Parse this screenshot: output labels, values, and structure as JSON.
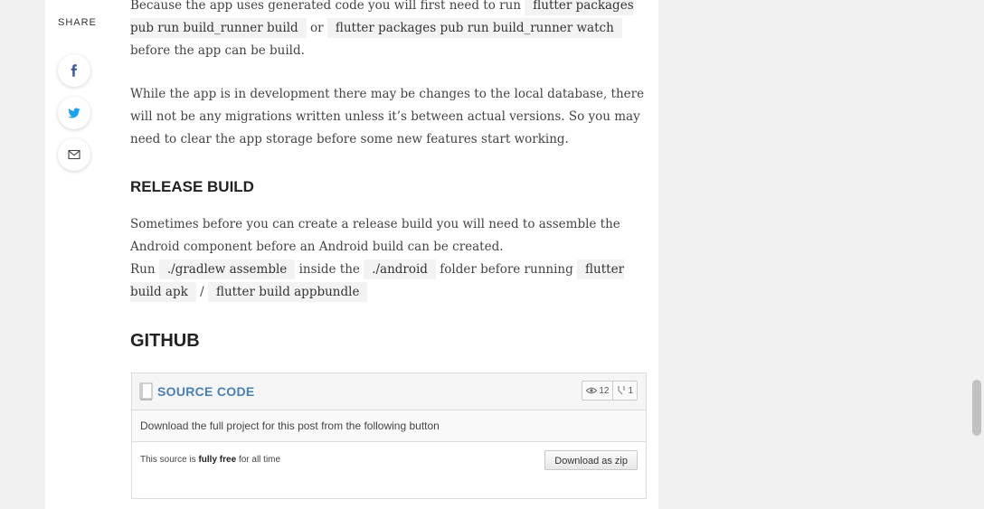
{
  "share": {
    "label": "SHARE",
    "buttons": [
      {
        "icon": "facebook-icon",
        "color": "#3b5998"
      },
      {
        "icon": "twitter-icon",
        "color": "#1da1f2"
      },
      {
        "icon": "email-icon",
        "color": "#444444"
      }
    ]
  },
  "article": {
    "p1": {
      "t1": "Because the app uses generated code you will first need to run",
      "code1": "flutter packages pub run build_runner build",
      "t2": "or",
      "code2": "flutter packages pub run build_runner watch",
      "t3": "before the app can be build."
    },
    "p2": "While the app is in development there may be changes to the local database, there will not be any migrations written unless it’s between actual versions. So you may need to clear the app storage before some new features start working.",
    "release_heading": "RELEASE BUILD",
    "p3": "Sometimes before you can create a release build you will need to assemble the Android component before an Android build can be created.",
    "p4": {
      "t1": "Run",
      "code1": "./gradlew assemble",
      "t2": "inside the",
      "code2": "./android",
      "t3": "folder before running",
      "code3": "flutter build apk",
      "t4": "/",
      "code4": "flutter build appbundle"
    },
    "github_heading": "GITHUB"
  },
  "github_box": {
    "title": "SOURCE CODE",
    "watchers": "12",
    "forks": "1",
    "description": "Download the full project for this post from the following button",
    "free_pre": "This source is",
    "free_bold": "fully free",
    "free_post": "for all time",
    "download_label": "Download as zip",
    "title_color": "#4a7fb4"
  }
}
